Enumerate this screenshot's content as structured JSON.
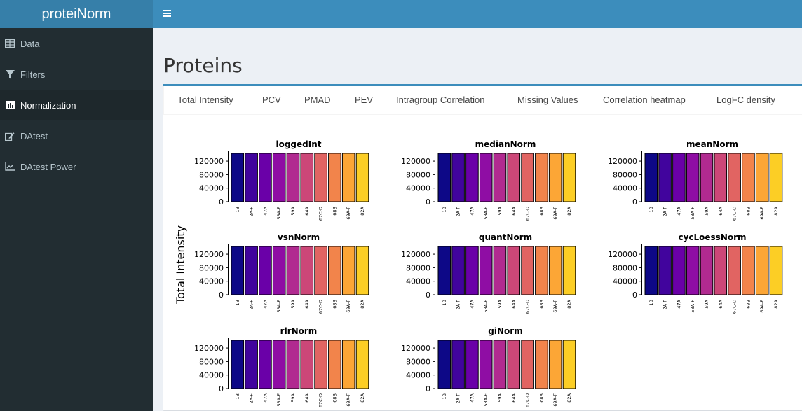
{
  "app": {
    "title": "proteiNorm"
  },
  "sidebar": {
    "items": [
      {
        "label": "Data",
        "icon": "table-icon",
        "active": false
      },
      {
        "label": "Filters",
        "icon": "filter-icon",
        "active": false
      },
      {
        "label": "Normalization",
        "icon": "bar-chart-icon",
        "active": true
      },
      {
        "label": "DAtest",
        "icon": "edit-icon",
        "active": false
      },
      {
        "label": "DAtest Power",
        "icon": "line-chart-icon",
        "active": false
      }
    ]
  },
  "page": {
    "title": "Proteins"
  },
  "tabs": [
    {
      "label": "Total Intensity",
      "active": true
    },
    {
      "label": "PCV"
    },
    {
      "label": "PMAD"
    },
    {
      "label": "PEV"
    },
    {
      "label": "Intragroup Correlation"
    },
    {
      "label": "Missing Values"
    },
    {
      "label": "Correlation heatmap"
    },
    {
      "label": "LogFC density"
    }
  ],
  "colors": {
    "header": "#3c8dbc",
    "logo_bg": "#367fa9",
    "sidebar_bg": "#222d32",
    "sidebar_active": "#1e282c",
    "bar_palette": [
      "#0d0887",
      "#41049d",
      "#6a00a8",
      "#8f0da4",
      "#b12a90",
      "#cc4778",
      "#e16462",
      "#f2844b",
      "#fca636",
      "#fcce25",
      "#f0f921"
    ]
  },
  "chart_data": {
    "type": "bar",
    "ylabel": "Total Intensity",
    "ylim": [
      0,
      145000
    ],
    "yticks": [
      0,
      40000,
      80000,
      120000
    ],
    "categories": [
      "1B",
      "2A-F",
      "47A",
      "58A-F",
      "59A",
      "64A",
      "67C-D",
      "68B",
      "69A-F",
      "82A"
    ],
    "panels": [
      {
        "title": "loggedInt",
        "values": [
          143000,
          143000,
          143000,
          143000,
          143000,
          143000,
          143000,
          143000,
          143000,
          143000
        ]
      },
      {
        "title": "medianNorm",
        "values": [
          143000,
          143000,
          143000,
          143000,
          143000,
          143000,
          143000,
          143000,
          143000,
          143000
        ]
      },
      {
        "title": "meanNorm",
        "values": [
          143000,
          143000,
          143000,
          143000,
          143000,
          143000,
          143000,
          143000,
          143000,
          143000
        ]
      },
      {
        "title": "vsnNorm",
        "values": [
          143000,
          143000,
          143000,
          143000,
          143000,
          143000,
          143000,
          143000,
          143000,
          143000
        ]
      },
      {
        "title": "quantNorm",
        "values": [
          143000,
          143000,
          143000,
          143000,
          143000,
          143000,
          143000,
          143000,
          143000,
          143000
        ]
      },
      {
        "title": "cycLoessNorm",
        "values": [
          143000,
          143000,
          143000,
          143000,
          143000,
          143000,
          143000,
          143000,
          143000,
          143000
        ]
      },
      {
        "title": "rlrNorm",
        "values": [
          143000,
          143000,
          143000,
          143000,
          143000,
          143000,
          143000,
          143000,
          143000,
          143000
        ]
      },
      {
        "title": "giNorm",
        "values": [
          143000,
          143000,
          143000,
          143000,
          143000,
          143000,
          143000,
          143000,
          143000,
          143000
        ]
      }
    ]
  }
}
